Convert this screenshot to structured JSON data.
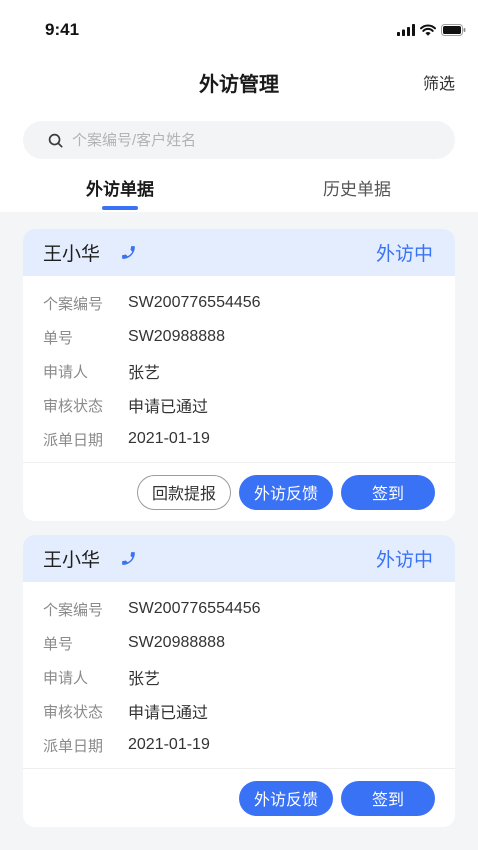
{
  "status_bar": {
    "time": "9:41",
    "icons": [
      "cellular-signal-icon",
      "wifi-icon",
      "battery-icon"
    ]
  },
  "header": {
    "title": "外访管理",
    "filter_label": "筛选"
  },
  "search": {
    "icon": "search-icon",
    "placeholder": "个案编号/客户姓名"
  },
  "tabs": [
    {
      "label": "外访单据",
      "active": true
    },
    {
      "label": "历史单据",
      "active": false
    }
  ],
  "cards": [
    {
      "name": "王小华",
      "contact_icon": "phone-icon",
      "status": "外访中",
      "fields": [
        {
          "label": "个案编号",
          "value": "SW200776554456"
        },
        {
          "label": "单号",
          "value": "SW20988888"
        },
        {
          "label": "申请人",
          "value": "张艺"
        },
        {
          "label": "审核状态",
          "value": "申请已通过"
        },
        {
          "label": "派单日期",
          "value": "2021-01-19"
        }
      ],
      "actions": [
        {
          "label": "回款提报",
          "primary": false
        },
        {
          "label": "外访反馈",
          "primary": true
        },
        {
          "label": "签到",
          "primary": true
        }
      ]
    },
    {
      "name": "王小华",
      "contact_icon": "phone-icon",
      "status": "外访中",
      "fields": [
        {
          "label": "个案编号",
          "value": "SW200776554456"
        },
        {
          "label": "单号",
          "value": "SW20988888"
        },
        {
          "label": "申请人",
          "value": "张艺"
        },
        {
          "label": "审核状态",
          "value": "申请已通过"
        },
        {
          "label": "派单日期",
          "value": "2021-01-19"
        }
      ],
      "actions": [
        {
          "label": "外访反馈",
          "primary": true
        },
        {
          "label": "签到",
          "primary": true
        }
      ]
    }
  ],
  "colors": {
    "accent": "#3a72f6",
    "card_header_bg": "#e4edfd",
    "page_bg": "#f4f5f7",
    "label_text": "#8a8a8a",
    "value_text": "#333333"
  }
}
